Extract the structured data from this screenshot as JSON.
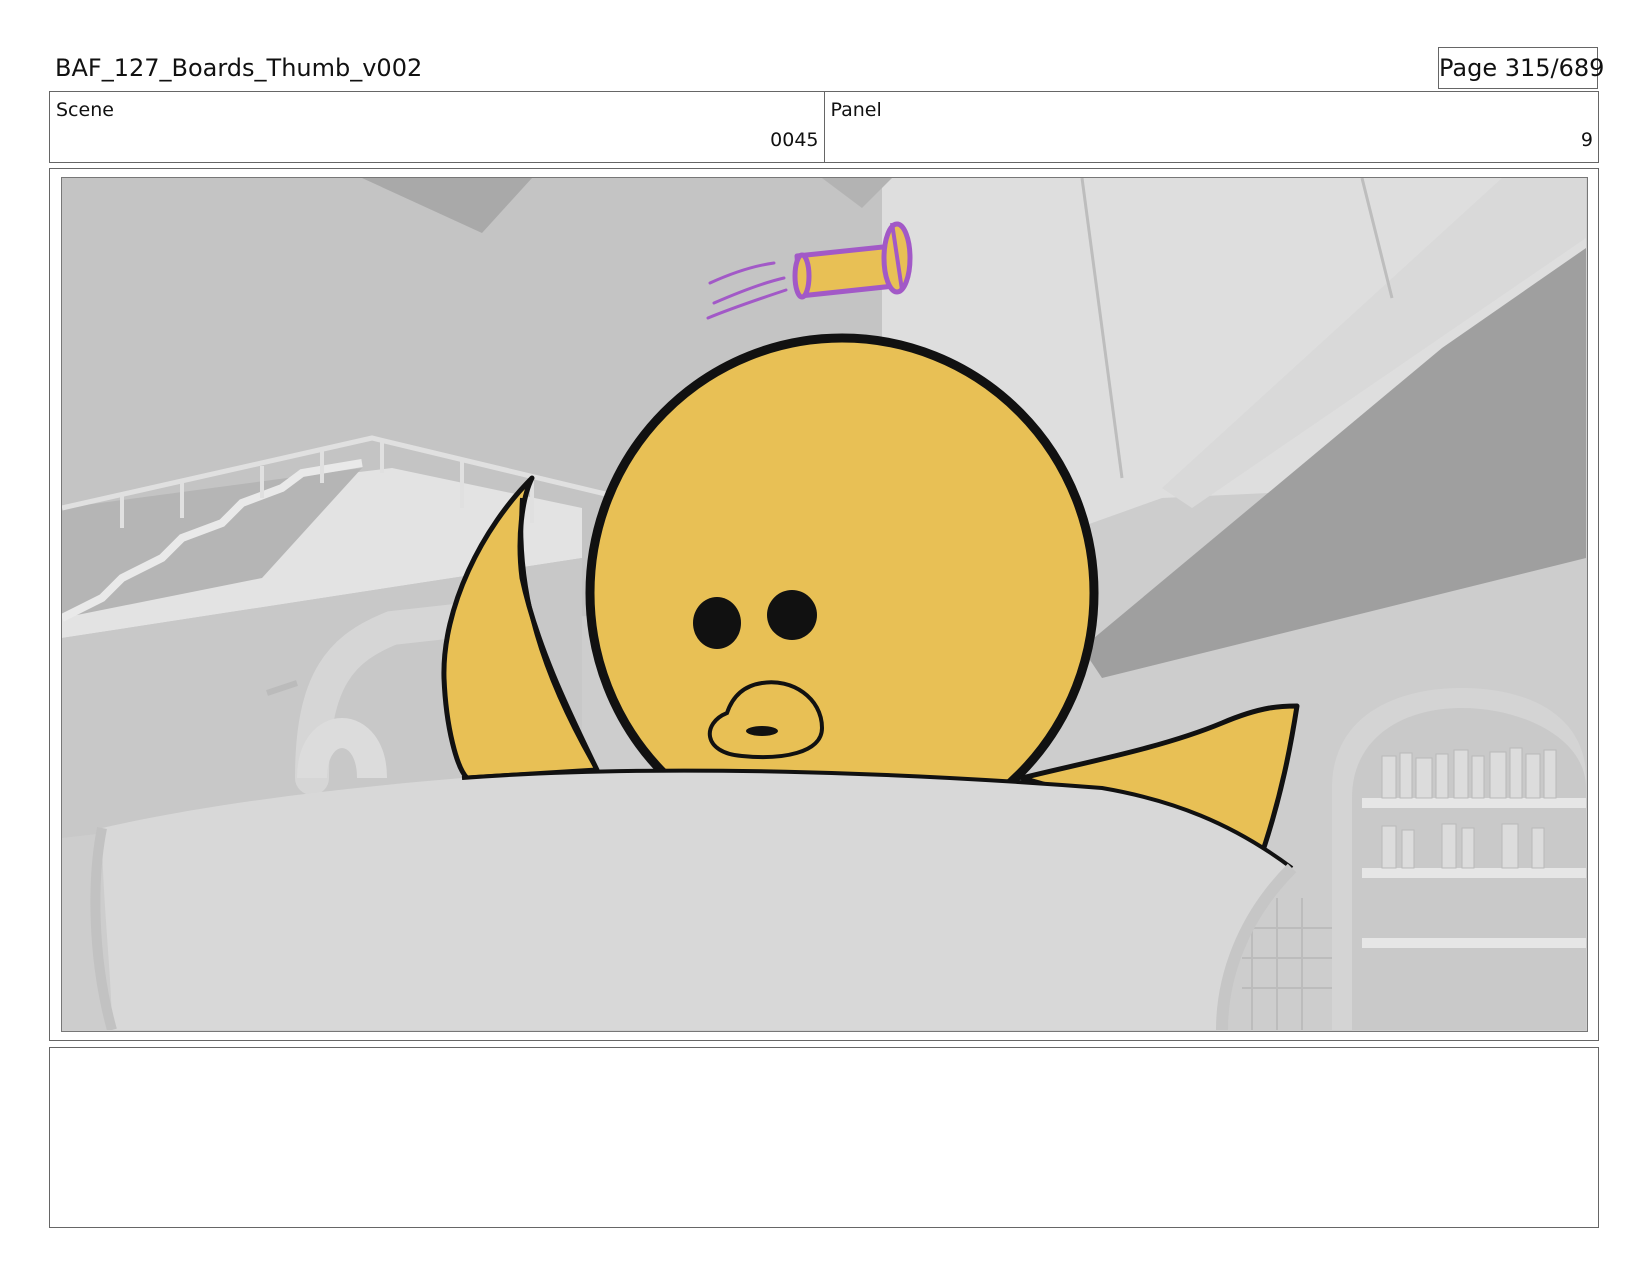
{
  "header": {
    "title": "BAF_127_Boards_Thumb_v002",
    "page": "Page 315/689"
  },
  "info": {
    "scene_label": "Scene",
    "scene_value": "0045",
    "panel_label": "Panel",
    "panel_value": "9"
  },
  "panel": {
    "palette": {
      "character_fill": "#E8C055",
      "ink": "#111111",
      "prop_purple": "#A259C7",
      "prop_fill": "#E8C055",
      "background_grey": "#CFCFCF"
    }
  },
  "notes": {
    "text": ""
  }
}
